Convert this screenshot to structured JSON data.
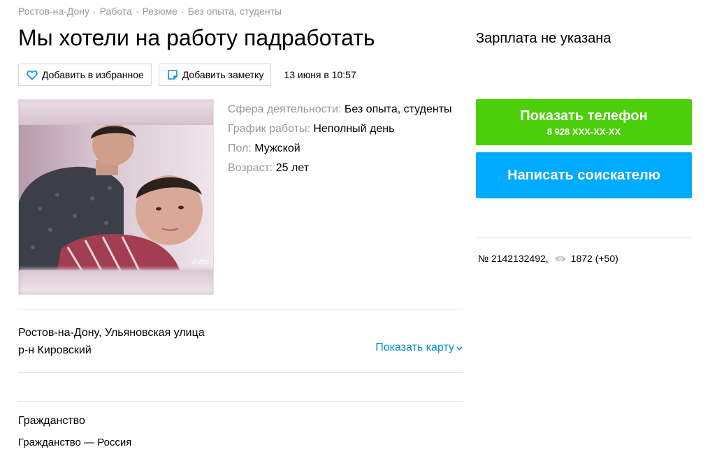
{
  "breadcrumbs": [
    "Ростов-на-Дону",
    "Работа",
    "Резюме",
    "Без опыта, студенты"
  ],
  "title": "Мы хотели на работу падработать",
  "actions": {
    "favorite_label": "Добавить в избранное",
    "note_label": "Добавить заметку",
    "date": "13 июня в 10:57"
  },
  "photo": {
    "watermark": "Avito"
  },
  "params": [
    {
      "key": "Сфера деятельности:",
      "value": "Без опыта, студенты"
    },
    {
      "key": "График работы:",
      "value": "Неполный день"
    },
    {
      "key": "Пол:",
      "value": "Мужской"
    },
    {
      "key": "Возраст:",
      "value": "25 лет"
    }
  ],
  "address": {
    "line1": "Ростов-на-Дону, Ульяновская улица",
    "line2": "р-н Кировский",
    "map_link": "Показать карту"
  },
  "citizenship": {
    "title": "Гражданство",
    "value": "Гражданство — Россия"
  },
  "sidebar": {
    "salary": "Зарплата не указана",
    "phone_button": "Показать телефон",
    "phone_masked": "8 928 XXX-XX-XX",
    "write_button": "Написать соискателю",
    "item_number": "№ 2142132492,",
    "views": "1872 (+50)"
  },
  "colors": {
    "green": "#4bcf09",
    "blue": "#00aaff",
    "link": "#0091d9"
  }
}
